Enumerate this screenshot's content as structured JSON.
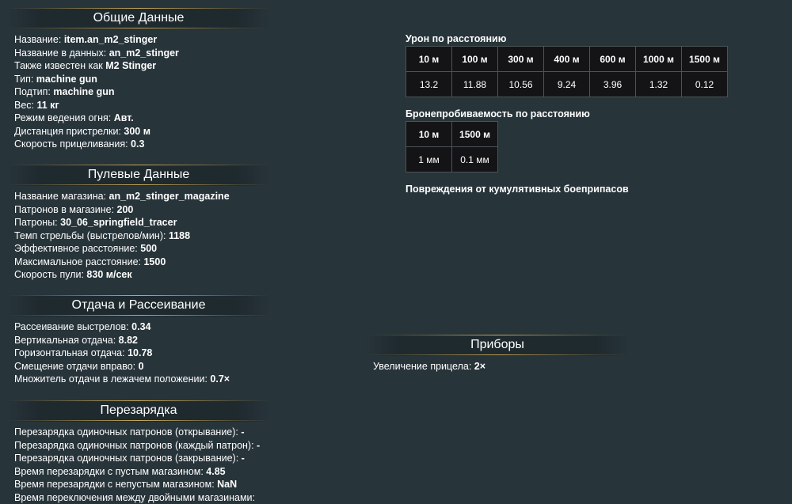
{
  "general": {
    "title": "Общие Данные",
    "rows": [
      {
        "label": "Название: ",
        "value": "item.an_m2_stinger"
      },
      {
        "label": "Название в данных: ",
        "value": "an_m2_stinger"
      },
      {
        "label": "Также известен как ",
        "value": "M2 Stinger"
      },
      {
        "label": "Тип: ",
        "value": "machine gun"
      },
      {
        "label": "Подтип: ",
        "value": "machine gun"
      },
      {
        "label": "Вес: ",
        "value": "11 кг"
      },
      {
        "label": "Режим ведения огня: ",
        "value": "Авт."
      },
      {
        "label": "Дистанция пристрелки: ",
        "value": "300 м"
      },
      {
        "label": "Скорость прицеливания: ",
        "value": "0.3"
      }
    ]
  },
  "bullet": {
    "title": "Пулевые Данные",
    "rows": [
      {
        "label": "Название магазина: ",
        "value": "an_m2_stinger_magazine"
      },
      {
        "label": "Патронов в магазине: ",
        "value": "200"
      },
      {
        "label": "Патроны: ",
        "value": "30_06_springfield_tracer"
      },
      {
        "label": "Темп стрельбы (выстрелов/мин): ",
        "value": "1188"
      },
      {
        "label": "Эффективное расстояние: ",
        "value": "500"
      },
      {
        "label": "Максимальное расстояние: ",
        "value": "1500"
      },
      {
        "label": "Скорость пули: ",
        "value": "830 м/сек"
      }
    ]
  },
  "recoil": {
    "title": "Отдача и Рассеивание",
    "rows": [
      {
        "label": "Рассеивание выстрелов: ",
        "value": "0.34"
      },
      {
        "label": "Вертикальная отдача: ",
        "value": "8.82"
      },
      {
        "label": "Горизонтальная отдача: ",
        "value": "10.78"
      },
      {
        "label": "Смещение отдачи вправо: ",
        "value": "0"
      },
      {
        "label": "Множитель отдачи в лежачем положении: ",
        "value": "0.7×"
      }
    ]
  },
  "reload": {
    "title": "Перезарядка",
    "rows": [
      {
        "label": "Перезарядка одиночных патронов (открывание): ",
        "value": "-"
      },
      {
        "label": "Перезарядка одиночных патронов (каждый патрон): ",
        "value": "-"
      },
      {
        "label": "Перезарядка одиночных патронов (закрывание): ",
        "value": "-"
      },
      {
        "label": "Время перезарядки с пустым магазином: ",
        "value": "4.85"
      },
      {
        "label": "Время перезарядки с непустым магазином: ",
        "value": "NaN"
      },
      {
        "label": "Время переключения между двойными магазинами: ",
        "value": ""
      }
    ]
  },
  "damage": {
    "caption": "Урон по расстоянию",
    "headers": [
      "10 м",
      "100 м",
      "300 м",
      "400 м",
      "600 м",
      "1000 м",
      "1500 м"
    ],
    "values": [
      "13.2",
      "11.88",
      "10.56",
      "9.24",
      "3.96",
      "1.32",
      "0.12"
    ]
  },
  "penetration": {
    "caption": "Бронепробиваемость по расстоянию",
    "headers": [
      "10 м",
      "1500 м"
    ],
    "values": [
      "1 мм",
      "0.1 мм"
    ]
  },
  "heat": {
    "caption": "Повреждения от кумулятивных боеприпасов"
  },
  "devices": {
    "title": "Приборы",
    "rows": [
      {
        "label": "Увеличение прицела: ",
        "value": "2×"
      }
    ]
  }
}
